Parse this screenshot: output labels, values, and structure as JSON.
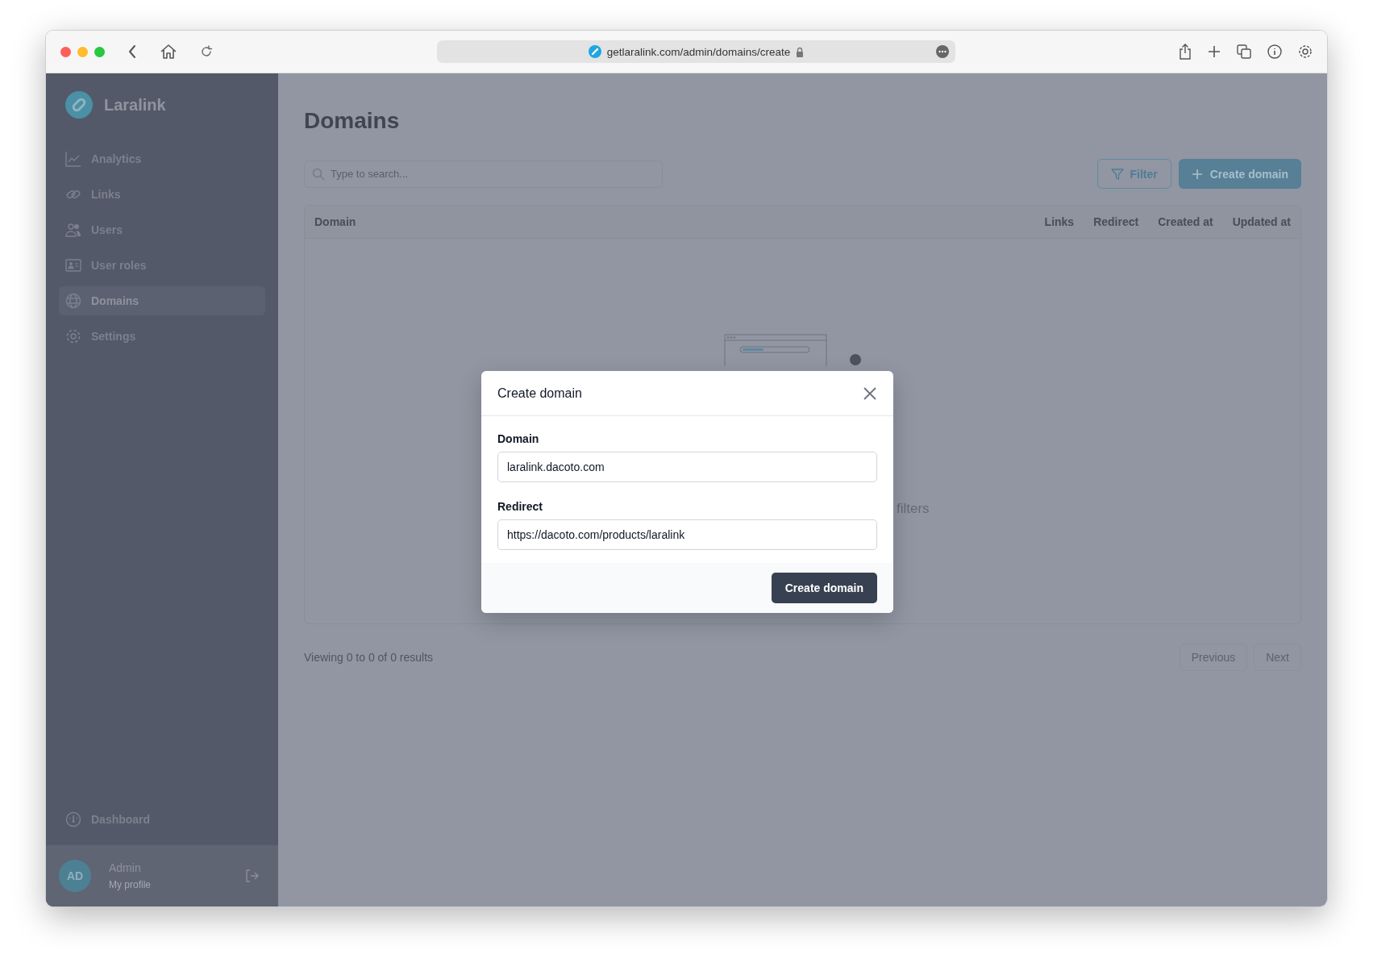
{
  "browser": {
    "url": "getlaralink.com/admin/domains/create"
  },
  "sidebar": {
    "brand": "Laralink",
    "items": [
      {
        "label": "Analytics",
        "selected": false
      },
      {
        "label": "Links",
        "selected": false
      },
      {
        "label": "Users",
        "selected": false
      },
      {
        "label": "User roles",
        "selected": false
      },
      {
        "label": "Domains",
        "selected": true
      },
      {
        "label": "Settings",
        "selected": false
      }
    ],
    "bottom_item": "Dashboard",
    "user": {
      "initials": "AD",
      "name": "Admin",
      "subtitle": "My profile"
    }
  },
  "page": {
    "title": "Domains",
    "search": {
      "placeholder": "Type to search..."
    },
    "filter_button": "Filter",
    "create_button": "Create domain",
    "table": {
      "columns": [
        "Domain",
        "Links",
        "Redirect",
        "Created at",
        "Updated at"
      ],
      "empty_text": "filters"
    },
    "footer": {
      "summary": "Viewing 0 to 0 of 0 results",
      "pagination": [
        {
          "label": "Previous",
          "disabled": true
        },
        {
          "label": "Next",
          "disabled": true
        }
      ]
    }
  },
  "modal": {
    "title": "Create domain",
    "fields": [
      {
        "label": "Domain",
        "value": "laralink.dacoto.com"
      },
      {
        "label": "Redirect",
        "value": "https://dacoto.com/products/laralink"
      }
    ],
    "submit": "Create domain"
  }
}
